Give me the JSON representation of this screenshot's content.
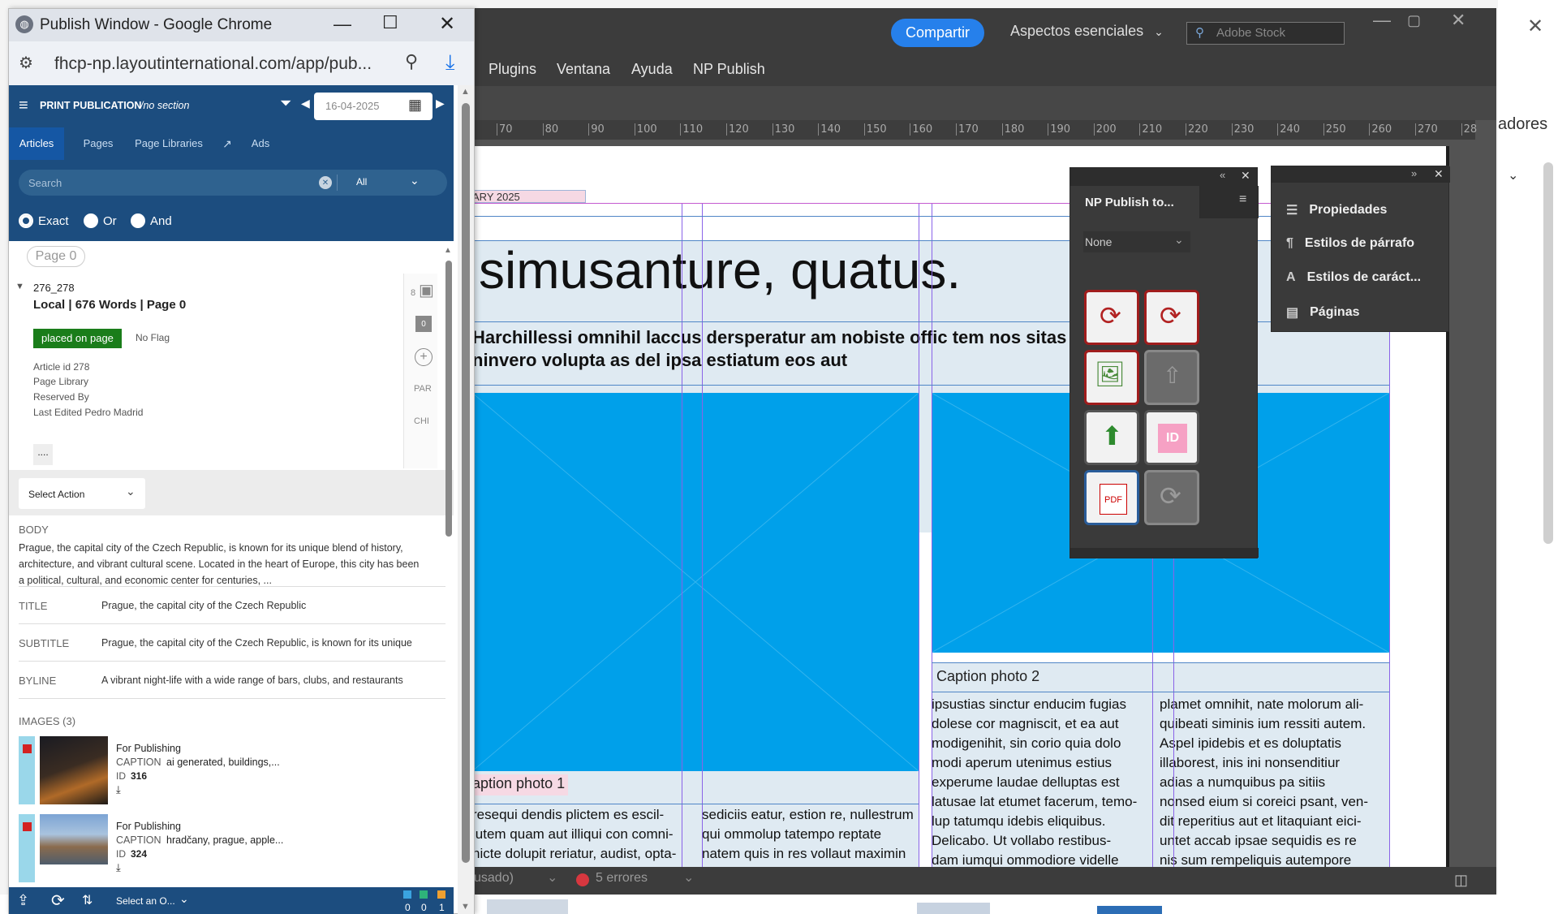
{
  "indesign": {
    "share_label": "Compartir",
    "workspace_label": "Aspectos esenciales",
    "stock_placeholder": "Adobe Stock",
    "menus": [
      "Plugins",
      "Ventana",
      "Ayuda",
      "NP Publish"
    ],
    "ruler_ticks": [
      "70",
      "80",
      "90",
      "100",
      "110",
      "120",
      "130",
      "140",
      "150",
      "160",
      "170",
      "180",
      "190",
      "200",
      "210",
      "220",
      "230",
      "240",
      "250",
      "260",
      "270",
      "28"
    ],
    "document": {
      "date_fragment": "ARY 2025",
      "headline": "simusanture, quatus.",
      "subhead": "Harchillessi omnihil laccus dersperatur am nobiste offic tem nos sitas ut aut mil\nninvero volupta as del ipsa estiatum eos aut",
      "caption1": "aption photo 1",
      "caption2": "Caption photo 2",
      "col1": "resequi dendis plictem es escil-\nlutem quam aut illiqui con comni-\nhicte dolupit reriatur, audist, opta-",
      "col2": "sediciis eatur, estion re, nullestrum\nqui ommolup tatempo reptate\nnatem quis in res vollaut maximin",
      "col3": "ipsustias sinctur enducim fugias\ndolese cor magniscit, et ea aut\nmodigenihit, sin corio quia dolo\nmodi aperum utenimus estius\nexperume laudae delluptas est\nlatusae lat etumet facerum, temo-\nlup tatumqu idebis eliquibus.\n   Delicabo. Ut vollabo restibus-\ndam iumqui ommodiore videlle",
      "col4": "plamet omnihit, nate molorum ali-\nquibeati siminis ium ressiti autem.\nAspel ipidebis et es doluptatis\nillaborest, inis ini nonsenditiur\nadias a numquibus pa sitiis\nnonsed eium si coreici psant, ven-\ndit reperitius aut et litaquiant eici-\nuntet accab ipsae sequidis es re\nnis sum rempeliquis autempore"
    },
    "status_left": "usado)",
    "status_errors": "5 errores"
  },
  "np_panel": {
    "title": "NP Publish to...",
    "dropdown_value": "None"
  },
  "props_panel": {
    "items": [
      "Propiedades",
      "Estilos de párrafo",
      "Estilos de caráct...",
      "Páginas"
    ]
  },
  "right_bg": {
    "text": "adores"
  },
  "chrome": {
    "title": "Publish Window - Google Chrome",
    "url": "fhcp-np.layoutinternational.com/app/pub..."
  },
  "np": {
    "app_title": "PRINT PUBLICATION",
    "section": "/no section",
    "date": "16-04-2025",
    "tabs": [
      "Articles",
      "Pages",
      "Page Libraries",
      "Ads"
    ],
    "search_placeholder": "Search",
    "filter_value": "All",
    "radios": [
      "Exact",
      "Or",
      "And"
    ],
    "page_chip": "Page 0",
    "article": {
      "id_line": "276_278",
      "summary": "Local | 676 Words | Page 0",
      "status": "placed on page",
      "flag": "No Flag",
      "meta": [
        "Article id 278",
        "Page Library",
        "Reserved By",
        "Last Edited Pedro Madrid"
      ],
      "more": "....",
      "side_count": "8",
      "comment_count": "0",
      "side_par": "PAR",
      "side_chi": "CHI"
    },
    "select_action": "Select Action",
    "body_label": "BODY",
    "body_text": "Prague, the capital city of the Czech Republic, is known for its unique blend of history, architecture, and vibrant cultural scene. Located in the heart of Europe, this city has been a political, cultural, and economic center for centuries, ...",
    "fields": [
      {
        "label": "TITLE",
        "value": "Prague, the capital city of the Czech Republic"
      },
      {
        "label": "SUBTITLE",
        "value": "Prague, the capital city of the Czech Republic, is known for its unique"
      },
      {
        "label": "BYLINE",
        "value": "A vibrant night-life with a wide range of bars, clubs, and restaurants"
      }
    ],
    "images_label": "IMAGES (3)",
    "images": [
      {
        "status": "For Publishing",
        "caption_label": "CAPTION",
        "caption": "ai generated, buildings,...",
        "id_label": "ID",
        "id": "316"
      },
      {
        "status": "For Publishing",
        "caption_label": "CAPTION",
        "caption": "hradčany, prague, apple...",
        "id_label": "ID",
        "id": "324"
      }
    ],
    "bottom_select": "Select an O...",
    "counters": [
      "0",
      "0",
      "1"
    ]
  },
  "colors": {
    "np_blue": "#1c4d7f",
    "placed_green": "#1a7d1a",
    "image_blue": "#00a0ea"
  }
}
